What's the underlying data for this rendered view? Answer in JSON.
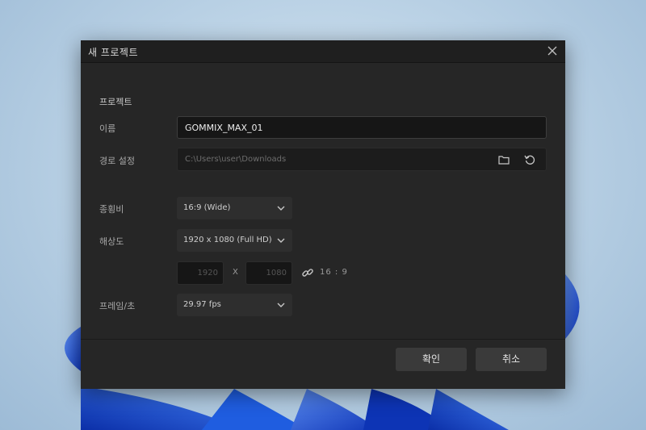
{
  "dialog": {
    "title": "새 프로젝트",
    "section_title": "프로젝트",
    "name": {
      "label": "이름",
      "value": "GOMMIX_MAX_01"
    },
    "path": {
      "label": "경로 설정",
      "value": "C:\\Users\\user\\Downloads"
    },
    "aspect": {
      "label": "종횡비",
      "value": "16:9 (Wide)"
    },
    "resolution": {
      "label": "해상도",
      "value": "1920 x 1080 (Full HD)",
      "width": "1920",
      "height": "1080",
      "times": "X",
      "ratio": "16 : 9"
    },
    "framerate": {
      "label": "프레임/초",
      "value": "29.97 fps"
    },
    "ok_label": "확인",
    "cancel_label": "취소"
  },
  "colors": {
    "dialog_bg": "#262626",
    "titlebar_bg": "#1f1f1f",
    "button_bg": "#3a3a3a",
    "wallpaper_blue": "#1f5de0"
  }
}
